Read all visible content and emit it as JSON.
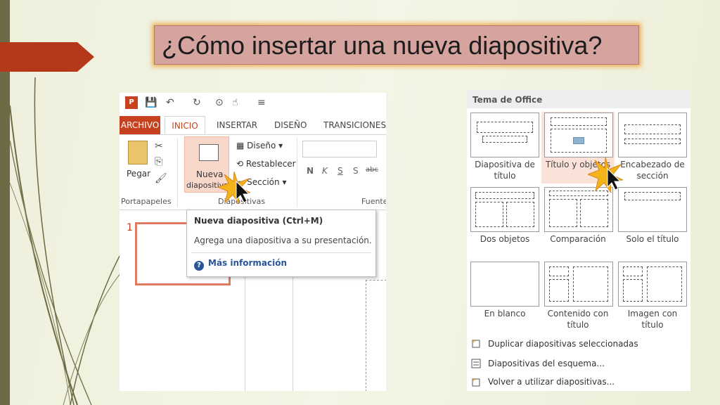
{
  "slide": {
    "title": "¿Cómo insertar una nueva diapositiva?",
    "colors": {
      "accent": "#b4391b",
      "title_bg": "#d5a49f",
      "glow": "#efb05a",
      "band": "#6d6a45"
    }
  },
  "ribbon_shot": {
    "tabs": [
      "ARCHIVO",
      "INICIO",
      "INSERTAR",
      "DISEÑO",
      "TRANSICIONES"
    ],
    "buttons": {
      "pegar": "Pegar",
      "nueva_line1": "Nueva",
      "nueva_line2": "diapositiva",
      "diseno": "Diseño",
      "restablecer": "Restablecer",
      "seccion": "Sección"
    },
    "format_letters": [
      "N",
      "K",
      "S",
      "S",
      "abc"
    ],
    "groups": [
      "Portapapeles",
      "Diapositivas",
      "Fuente"
    ],
    "tooltip": {
      "title": "Nueva diapositiva (Ctrl+M)",
      "description": "Agrega una diapositiva a su presentación.",
      "help": "Más información"
    },
    "thumbnail_number": "1"
  },
  "layout_shot": {
    "header": "Tema de Office",
    "layouts": [
      {
        "label": "Diapositiva de título",
        "line1": "Diapositiva de",
        "line2": "título"
      },
      {
        "label": "Título y objetos",
        "line1": "Título y objetos",
        "line2": ""
      },
      {
        "label": "Encabezado de sección",
        "line1": "Encabezado de",
        "line2": "sección"
      },
      {
        "label": "Dos objetos",
        "line1": "Dos objetos",
        "line2": ""
      },
      {
        "label": "Comparación",
        "line1": "Comparación",
        "line2": ""
      },
      {
        "label": "Solo el título",
        "line1": "Solo el título",
        "line2": ""
      },
      {
        "label": "En blanco",
        "line1": "En blanco",
        "line2": ""
      },
      {
        "label": "Contenido con título",
        "line1": "Contenido con",
        "line2": "título"
      },
      {
        "label": "Imagen con título",
        "line1": "Imagen con título",
        "line2": ""
      }
    ],
    "menu": [
      "Duplicar diapositivas seleccionadas",
      "Diapositivas del esquema...",
      "Volver a utilizar diapositivas..."
    ]
  }
}
